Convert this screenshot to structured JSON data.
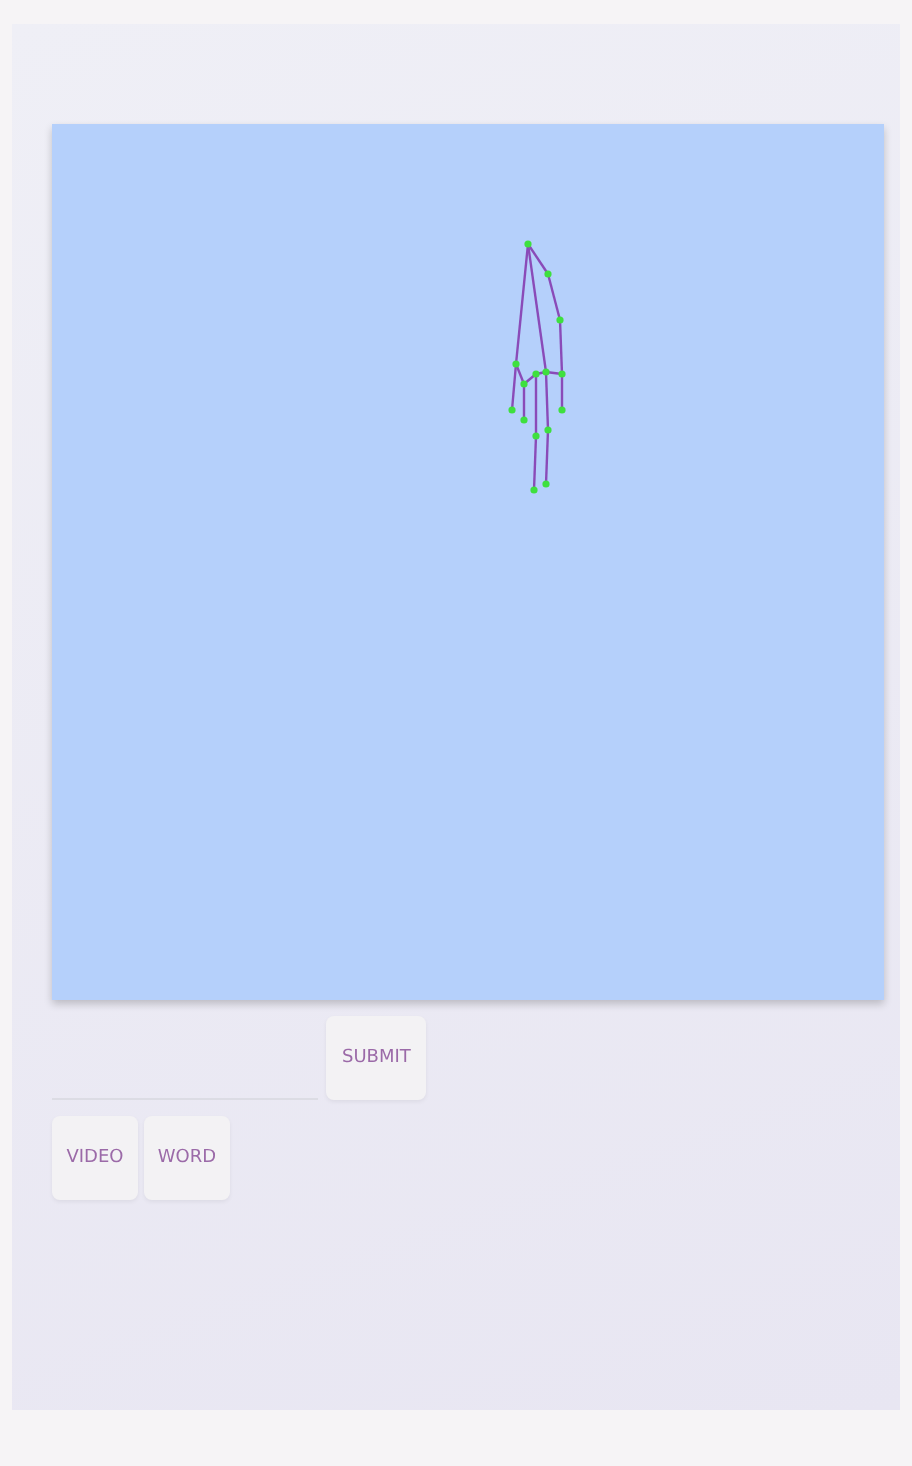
{
  "canvas": {
    "kind": "hand-landmarks"
  },
  "form": {
    "submit": "SUBMIT"
  },
  "modes": [
    {
      "label": "VIDEO"
    },
    {
      "label": "WORD"
    }
  ]
}
